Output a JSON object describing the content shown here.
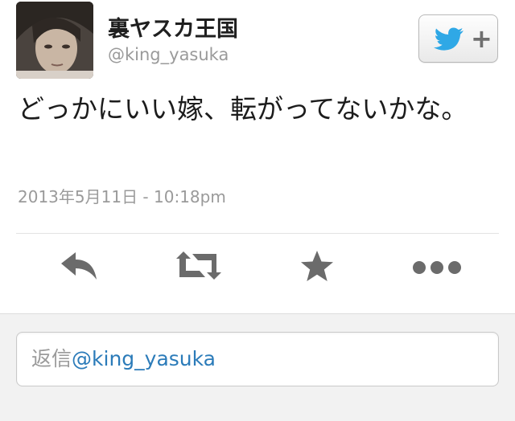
{
  "tweet": {
    "display_name": "裏ヤスカ王国",
    "screen_name": "@king_yasuka",
    "text": "どっかにいい嫁、転がってないかな。",
    "timestamp": "2013年5月11日 - 10:18pm"
  },
  "follow_button": {
    "icon": "twitter-bird-icon",
    "plus_label": "+",
    "accent": "#2fa8e6"
  },
  "actions": [
    {
      "icon": "reply-icon"
    },
    {
      "icon": "retweet-icon"
    },
    {
      "icon": "favorite-star-icon"
    },
    {
      "icon": "more-icon"
    }
  ],
  "reply_box": {
    "prefix": "返信",
    "mention": "@king_yasuka",
    "mention_color": "#2b7bb9"
  }
}
